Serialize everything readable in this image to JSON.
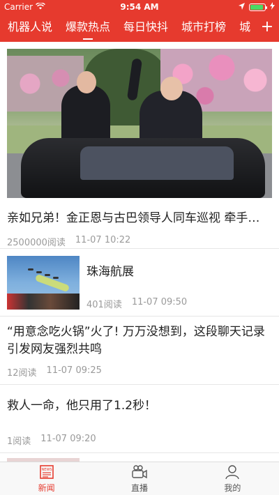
{
  "status_bar": {
    "carrier": "Carrier",
    "time": "9:54 AM",
    "battery_level": 0.9
  },
  "nav": {
    "tabs": [
      {
        "label": "机器人说",
        "active": false
      },
      {
        "label": "爆款热点",
        "active": true
      },
      {
        "label": "每日快抖",
        "active": false
      },
      {
        "label": "城市打榜",
        "active": false
      },
      {
        "label": "城",
        "active": false
      }
    ],
    "add_label": "+"
  },
  "feed": {
    "items": [
      {
        "title": "亲如兄弟！金正恩与古巴领导人同车巡视 牵手…",
        "reads": "2500000阅读",
        "time": "11-07 10:22"
      },
      {
        "title": "珠海航展",
        "reads": "401阅读",
        "time": "11-07 09:50"
      },
      {
        "title": "“用意念吃火锅”火了! 万万没想到，这段聊天记录引发网友强烈共鸣",
        "reads": "12阅读",
        "time": "11-07 09:25"
      },
      {
        "title": "救人一命，他只用了1.2秒！",
        "reads": "1阅读",
        "time": "11-07 09:20"
      }
    ]
  },
  "tab_bar": {
    "items": [
      {
        "label": "新闻",
        "icon": "news-icon",
        "active": true
      },
      {
        "label": "直播",
        "icon": "live-camera-icon",
        "active": false
      },
      {
        "label": "我的",
        "icon": "profile-icon",
        "active": false
      }
    ],
    "news_icon_text": "NEWS"
  },
  "colors": {
    "brand": "#e63a2e",
    "meta_text": "#9a9a9a"
  }
}
